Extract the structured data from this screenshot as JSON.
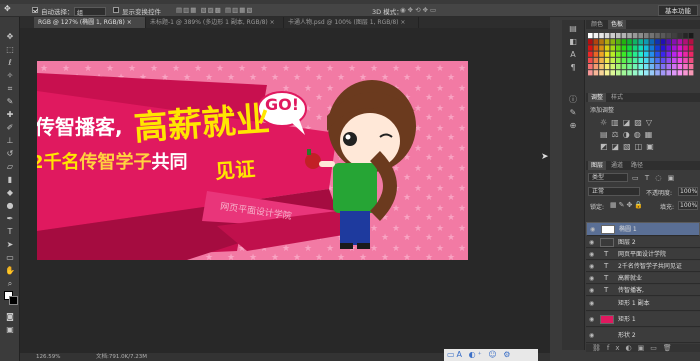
{
  "app": {
    "workspace_button": "基本功能"
  },
  "options_bar": {
    "auto_select_label": "自动选择：",
    "auto_select_value": "组",
    "show_transform_label": "显示变换控件",
    "mode_3d_label": "3D 模式："
  },
  "tabs": [
    {
      "label": "RGB @ 127% (椭圆 1, RGB/8) ×"
    },
    {
      "label": "未标题-1 @ 389% (多边形 1 副本, RGB/8) ×"
    },
    {
      "label": "卡通人物.psd @ 100% (图层 1, RGB/8) ×"
    }
  ],
  "banner": {
    "line1": "传智播客,",
    "headline": "高薪就业",
    "line2_prefix": "2千名",
    "line2_highlight": "传智学子",
    "line2_suffix": "共同",
    "witness": "见证",
    "go_bubble": "GO!",
    "ribbon_text": "网页平面设计学院"
  },
  "status": {
    "zoom": "126.59%",
    "doc": "文档:791.0K/7.23M"
  },
  "panels": {
    "color_tabs": [
      "颜色",
      "色板"
    ],
    "adjust_tabs": [
      "调整",
      "样式"
    ],
    "adjust_title": "添加调整",
    "layer_tabs": [
      "图层",
      "通道",
      "路径"
    ],
    "kind_label": "类型",
    "blend_mode": "正常",
    "opacity_label": "不透明度:",
    "opacity_value": "100%",
    "lock_label": "锁定:",
    "fill_label": "填充:",
    "fill_value": "100%"
  },
  "layers": [
    {
      "name": "椭圆 1",
      "type": "shape",
      "selected": true
    },
    {
      "name": "图层 2",
      "type": "pixel",
      "selected": false
    },
    {
      "name": "网页平面设计学院",
      "type": "text",
      "selected": false
    },
    {
      "name": "2千名传智学子共同见证",
      "type": "text",
      "selected": false
    },
    {
      "name": "高薪就业",
      "type": "text",
      "selected": false
    },
    {
      "name": "传智播客,",
      "type": "text",
      "selected": false
    },
    {
      "name": "矩形 1 副本",
      "type": "shape",
      "selected": false
    },
    {
      "name": "矩形 1",
      "type": "shape",
      "selected": false
    },
    {
      "name": "形状 2",
      "type": "shape",
      "selected": false
    }
  ],
  "colors": {
    "accent": "#5a6f95",
    "banner_pink": "#f27aa4",
    "banner_magenta": "#e0195f",
    "headline_yellow": "#ffe600"
  }
}
